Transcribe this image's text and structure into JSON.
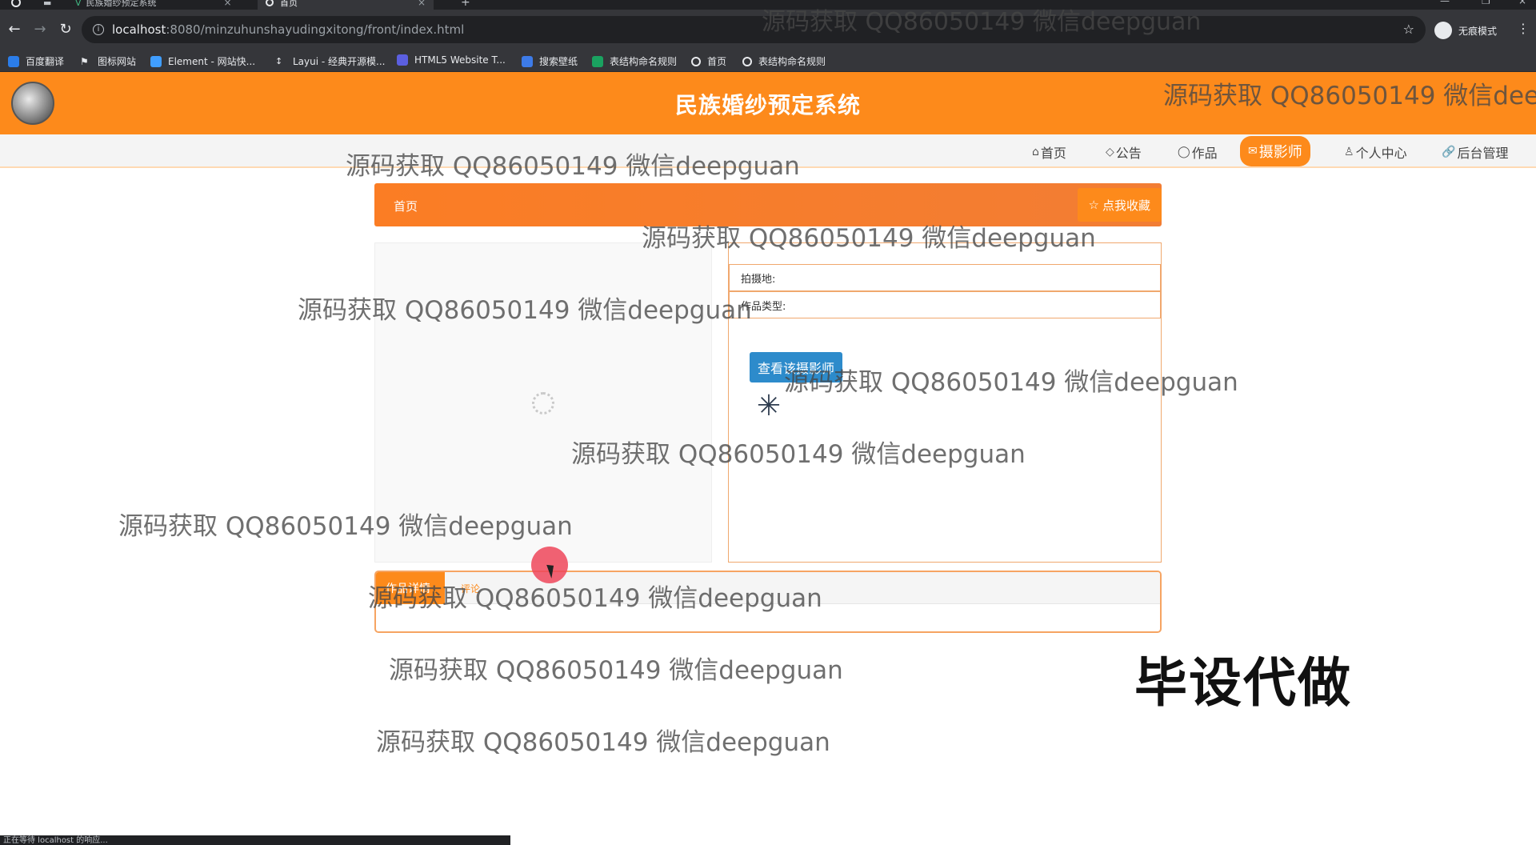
{
  "browser": {
    "tabs": [
      {
        "title": "民族婚纱预定系统"
      },
      {
        "title": "首页"
      }
    ],
    "new_tab": "+",
    "url_host": "localhost",
    "url_path": ":8080/minzuhunshayudingxitong/front/index.html",
    "incognito_label": "无痕模式",
    "bookmarks": [
      {
        "label": "百度翻译",
        "color": "#2b7de9"
      },
      {
        "label": "图标网站",
        "color": "#e8eaed"
      },
      {
        "label": "Element - 网站快...",
        "color": "#409eff"
      },
      {
        "label": "Layui - 经典开源模...",
        "color": "#e8eaed"
      },
      {
        "label": "HTML5 Website T...",
        "color": "#5b5fe0"
      },
      {
        "label": "搜索壁纸",
        "color": "#3d7be8"
      },
      {
        "label": "表结构命名规则",
        "color": "#1aa260"
      },
      {
        "label": "首页",
        "color": "#e8eaed"
      },
      {
        "label": "表结构命名规则",
        "color": "#e8eaed"
      }
    ],
    "status_text": "正在等待 localhost 的响应..."
  },
  "site": {
    "title": "民族婚纱预定系统",
    "nav": [
      {
        "label": "首页",
        "icon": "home-icon",
        "glyph": "⌂"
      },
      {
        "label": "公告",
        "icon": "tag-icon",
        "glyph": "◇"
      },
      {
        "label": "作品",
        "icon": "power-icon",
        "glyph": "◯"
      },
      {
        "label": "摄影师",
        "icon": "mail-icon",
        "glyph": "✉"
      },
      {
        "label": "个人中心",
        "icon": "user-icon",
        "glyph": "♙"
      },
      {
        "label": "后台管理",
        "icon": "link-icon",
        "glyph": "🔗"
      }
    ],
    "active_nav": "摄影师",
    "accent_color": "#fd8a1b"
  },
  "main": {
    "breadcrumb": "首页",
    "favorite_button": "点我收藏",
    "fields": [
      {
        "label": "拍摄地:"
      },
      {
        "label": "作品类型:"
      }
    ],
    "view_button": "查看该摄影师",
    "detail_tabs": {
      "active": "作品详情",
      "other": "评论"
    }
  },
  "overlay": {
    "watermark_text": "源码获取 QQ86050149 微信deepguan",
    "caption": "毕设代做"
  }
}
